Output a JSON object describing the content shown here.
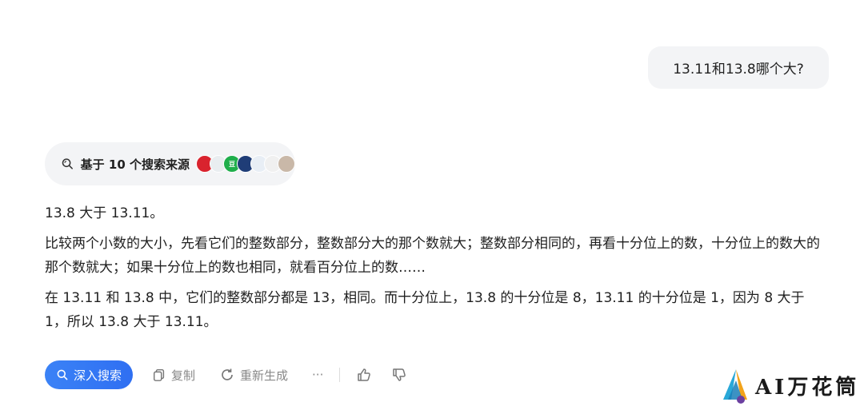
{
  "user_message": "13.11和13.8哪个大?",
  "sources": {
    "label": "基于 10 个搜索来源",
    "icon": "search-icon",
    "favicons": [
      {
        "color": "#d9232e",
        "text": ""
      },
      {
        "color": "#e9edf0",
        "text": ""
      },
      {
        "color": "#1fae4b",
        "text": "豆"
      },
      {
        "color": "#1f3d77",
        "text": ""
      },
      {
        "color": "#e8eef5",
        "text": ""
      },
      {
        "color": "#f0f0f0",
        "text": ""
      },
      {
        "color": "#c9b8a8",
        "text": ""
      }
    ]
  },
  "answer": {
    "p1": "13.8 大于 13.11。",
    "p2": "比较两个小数的大小，先看它们的整数部分，整数部分大的那个数就大；整数部分相同的，再看十分位上的数，十分位上的数大的那个数就大；如果十分位上的数也相同，就看百分位上的数……",
    "p3": "在 13.11 和 13.8 中，它们的整数部分都是 13，相同。而十分位上，13.8 的十分位是 8，13.11 的十分位是 1，因为 8 大于 1，所以 13.8 大于 13.11。"
  },
  "actions": {
    "deep_search": "深入搜索",
    "copy": "复制",
    "regenerate": "重新生成",
    "more": "···"
  },
  "watermark": "AI万花筒",
  "colors": {
    "accent": "#3b82f6",
    "bubble": "#f3f4f6",
    "muted": "#888888"
  }
}
